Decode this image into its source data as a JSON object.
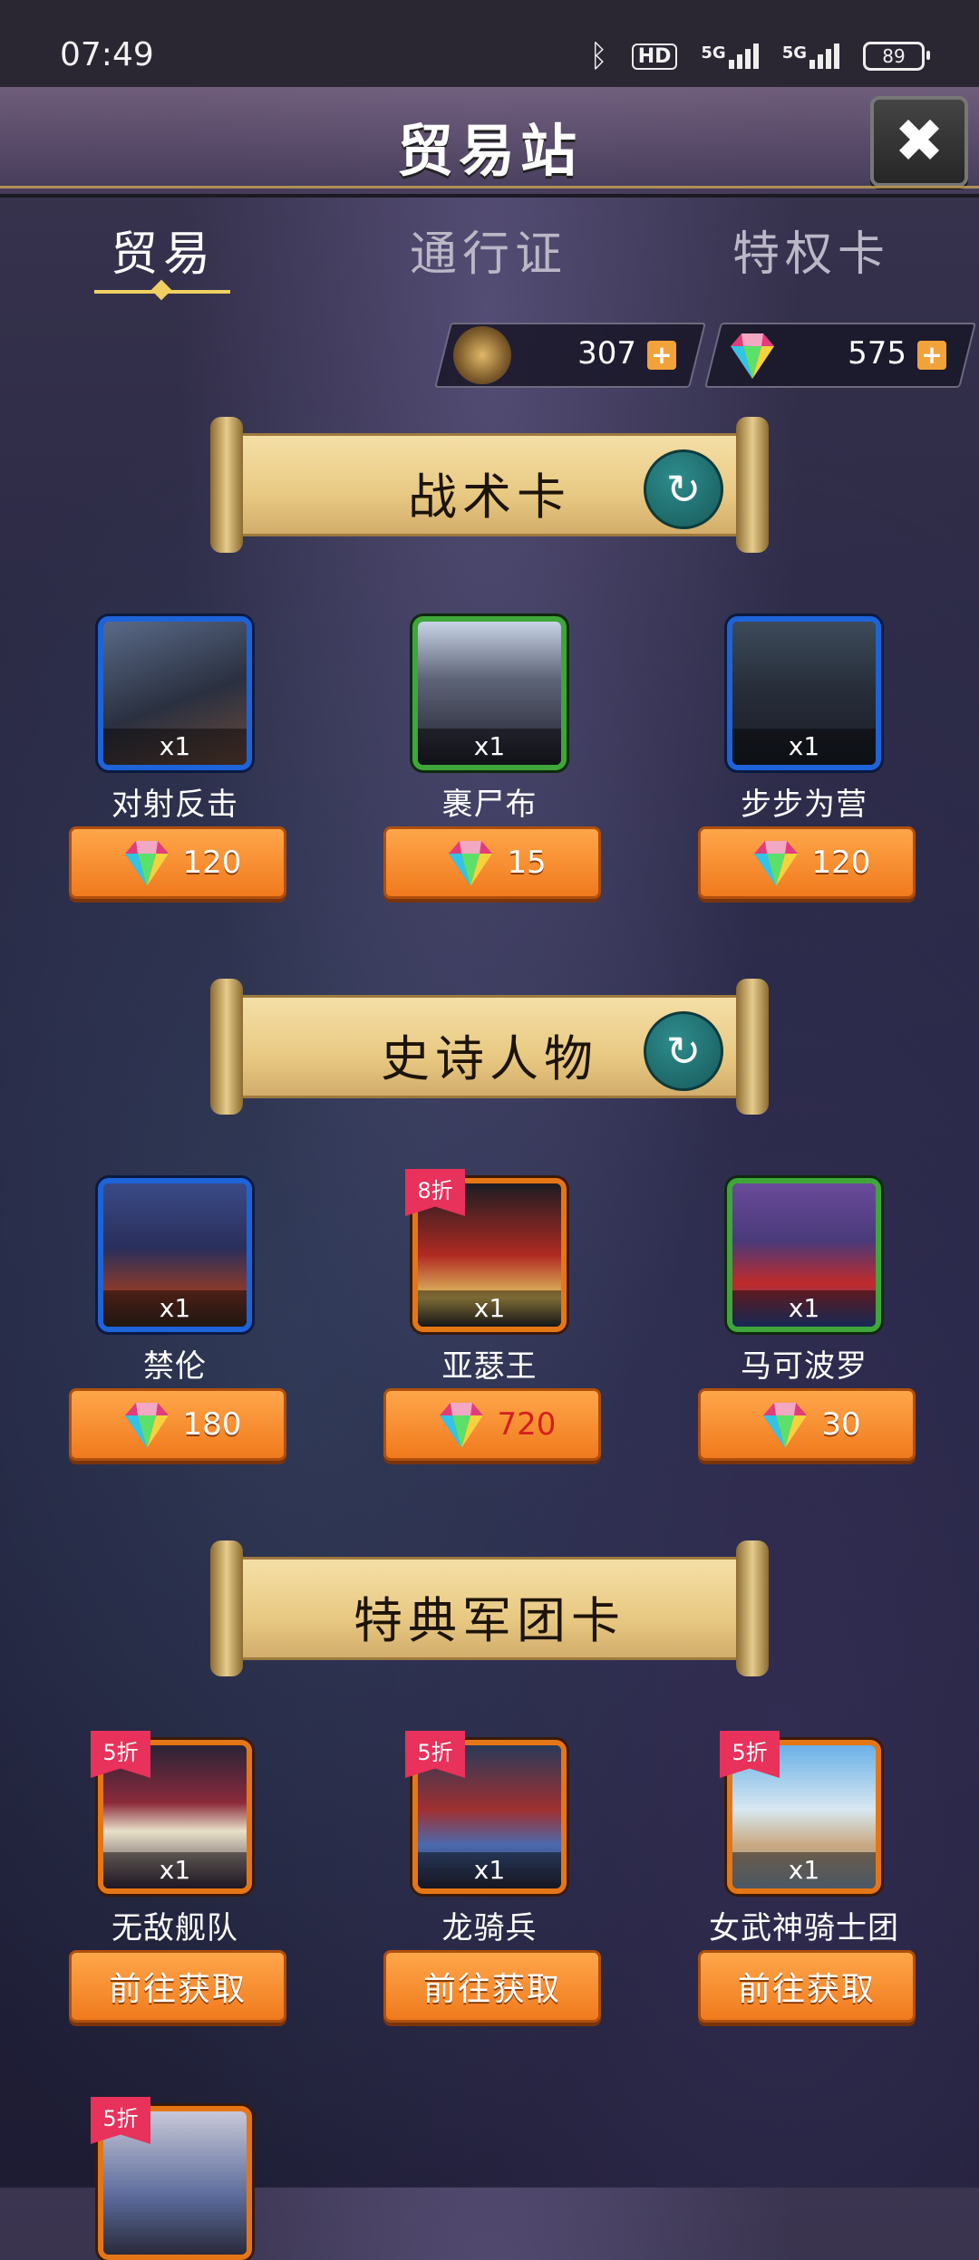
{
  "status_bar": {
    "time": "07:49",
    "battery": "89",
    "net1": "5G",
    "net2": "5G",
    "hd": "HD"
  },
  "header": {
    "title": "贸易站",
    "close_label": "✖"
  },
  "tabs": [
    {
      "label": "贸易",
      "active": true
    },
    {
      "label": "通行证",
      "active": false
    },
    {
      "label": "特权卡",
      "active": false
    }
  ],
  "currencies": [
    {
      "icon": "medal-icon",
      "value": "307"
    },
    {
      "icon": "gem-icon",
      "value": "575"
    }
  ],
  "sections": [
    {
      "title": "战术卡",
      "refresh": true,
      "items": [
        {
          "name": "对射反击",
          "qty": "x1",
          "price": "120",
          "frame": "blue"
        },
        {
          "name": "裹尸布",
          "qty": "x1",
          "price": "15",
          "frame": "green"
        },
        {
          "name": "步步为营",
          "qty": "x1",
          "price": "120",
          "frame": "blue"
        }
      ]
    },
    {
      "title": "史诗人物",
      "refresh": true,
      "items": [
        {
          "name": "禁伦",
          "qty": "x1",
          "price": "180",
          "frame": "blue"
        },
        {
          "name": "亚瑟王",
          "qty": "x1",
          "price": "720",
          "frame": "orange",
          "badge": "8折",
          "price_red": true
        },
        {
          "name": "马可波罗",
          "qty": "x1",
          "price": "30",
          "frame": "green"
        }
      ]
    },
    {
      "title": "特典军团卡",
      "refresh": false,
      "items": [
        {
          "name": "无敌舰队",
          "qty": "x1",
          "action": "前往获取",
          "frame": "orange",
          "badge": "5折"
        },
        {
          "name": "龙骑兵",
          "qty": "x1",
          "action": "前往获取",
          "frame": "orange",
          "badge": "5折"
        },
        {
          "name": "女武神骑士团",
          "qty": "x1",
          "action": "前往获取",
          "frame": "orange",
          "badge": "5折"
        }
      ]
    }
  ],
  "partial_item": {
    "badge": "5折",
    "frame": "orange"
  },
  "colors": {
    "accent_orange": "#f07a1d",
    "tab_underline": "#f0cf63",
    "badge": "#e8315b"
  }
}
